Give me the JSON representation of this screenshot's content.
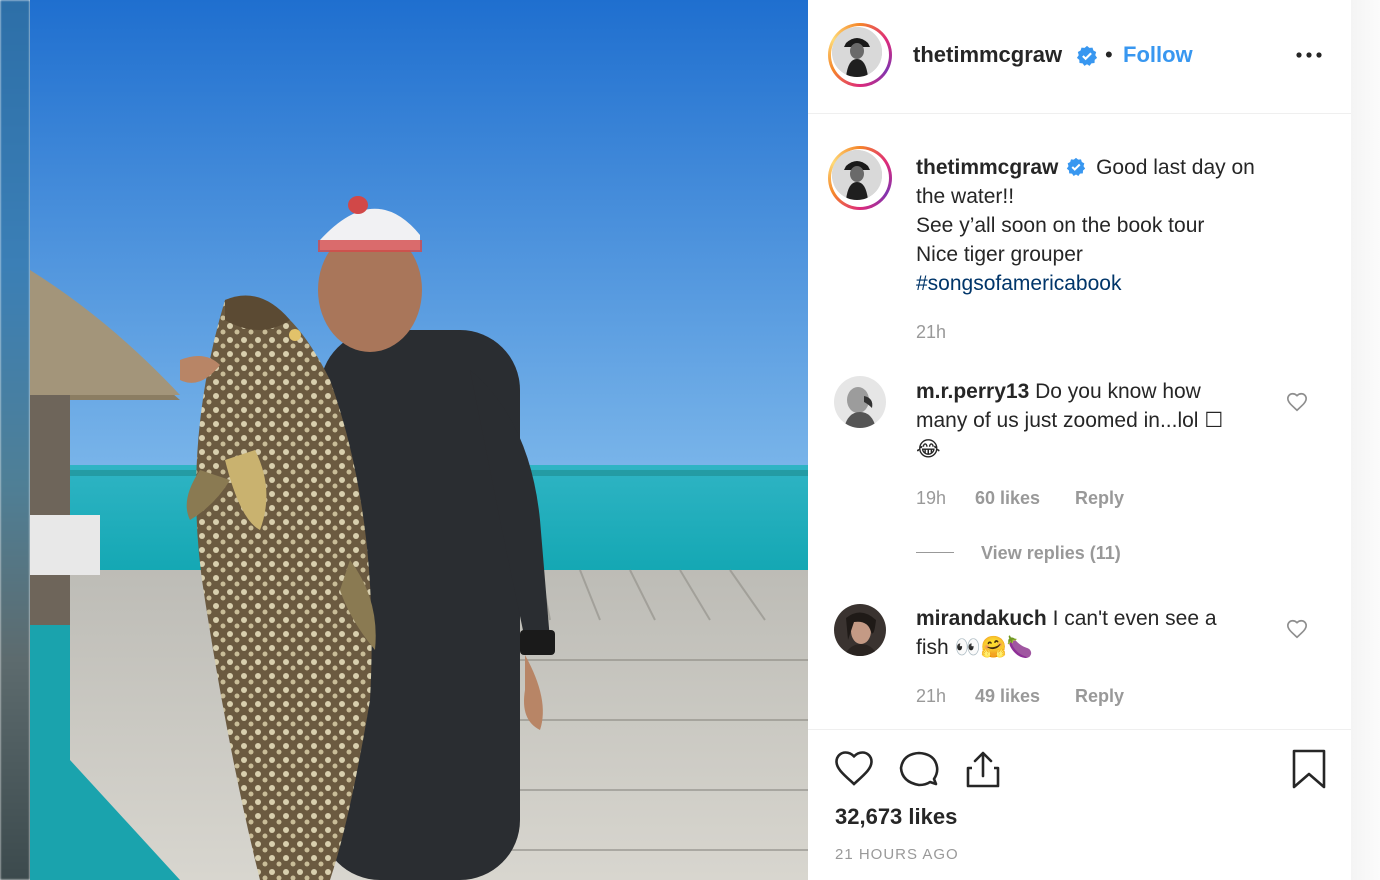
{
  "post": {
    "username": "thetimmcgraw",
    "separator": "•",
    "follow_label": "Follow",
    "more_icon": "more-horizontal-icon"
  },
  "caption": {
    "username": "thetimmcgraw",
    "line1": "Good last day on",
    "line2": "the water!!",
    "line3": "See y’all soon on the book tour",
    "line4": "Nice tiger grouper",
    "hashtag": "#songsofamericabook",
    "time": "21h"
  },
  "comments": [
    {
      "username": "m.r.perry13",
      "line1": "Do you know how",
      "line2": "many of us just zoomed in...lol",
      "line2_glyph": "☐",
      "line3": "😂",
      "time": "19h",
      "likes": "60 likes",
      "reply": "Reply",
      "view_replies": "View replies (11)"
    },
    {
      "username": "mirandakuch",
      "line1": "I can't even see a",
      "line2": "fish 👀🤗🍆",
      "time": "21h",
      "likes": "49 likes",
      "reply": "Reply"
    }
  ],
  "footer": {
    "likes": "32,673 likes",
    "time_ago": "21 HOURS AGO"
  },
  "colors": {
    "link": "#3897f0",
    "hashtag": "#003569",
    "verified": "#3897f0",
    "muted": "#999999"
  }
}
